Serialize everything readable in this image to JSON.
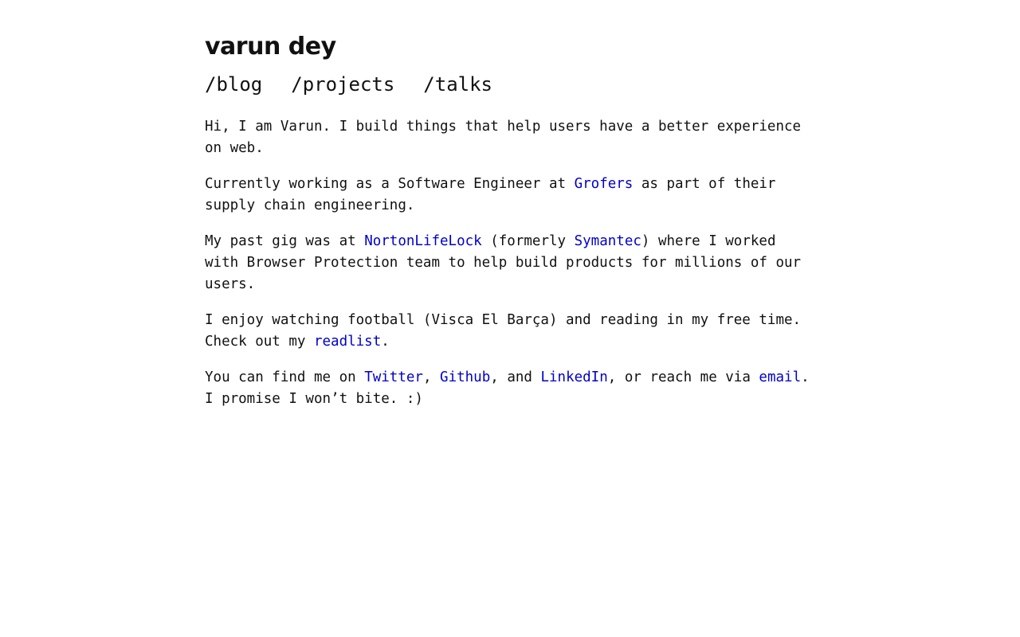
{
  "header": {
    "title": "varun dey",
    "nav": [
      {
        "label": "/blog"
      },
      {
        "label": "/projects"
      },
      {
        "label": "/talks"
      }
    ]
  },
  "intro": {
    "p1": "Hi, I am Varun. I build things that help users have a better experience on web.",
    "p2_pre": "Currently working as a Software Engineer at ",
    "p2_link": "Grofers",
    "p2_post": " as part of their supply chain engineering.",
    "p3_pre": "My past gig was at ",
    "p3_link1": "NortonLifeLock",
    "p3_mid": " (formerly ",
    "p3_link2": "Symantec",
    "p3_post": ") where I worked with Browser Protection team to help build products for millions of our users.",
    "p4_pre": "I enjoy watching football (Visca El Barça) and reading in my free time. Check out my ",
    "p4_link": "readlist",
    "p4_post": ".",
    "p5_pre": "You can find me on ",
    "p5_link_twitter": "Twitter",
    "p5_sep1": ", ",
    "p5_link_github": "Github",
    "p5_sep2": ", and ",
    "p5_link_linkedin": "LinkedIn",
    "p5_mid": ", or reach me via ",
    "p5_link_email": "email",
    "p5_post": ". I promise I won’t bite. :)"
  },
  "colors": {
    "text": "#111111",
    "link": "#0000cc",
    "background": "#ffffff"
  }
}
